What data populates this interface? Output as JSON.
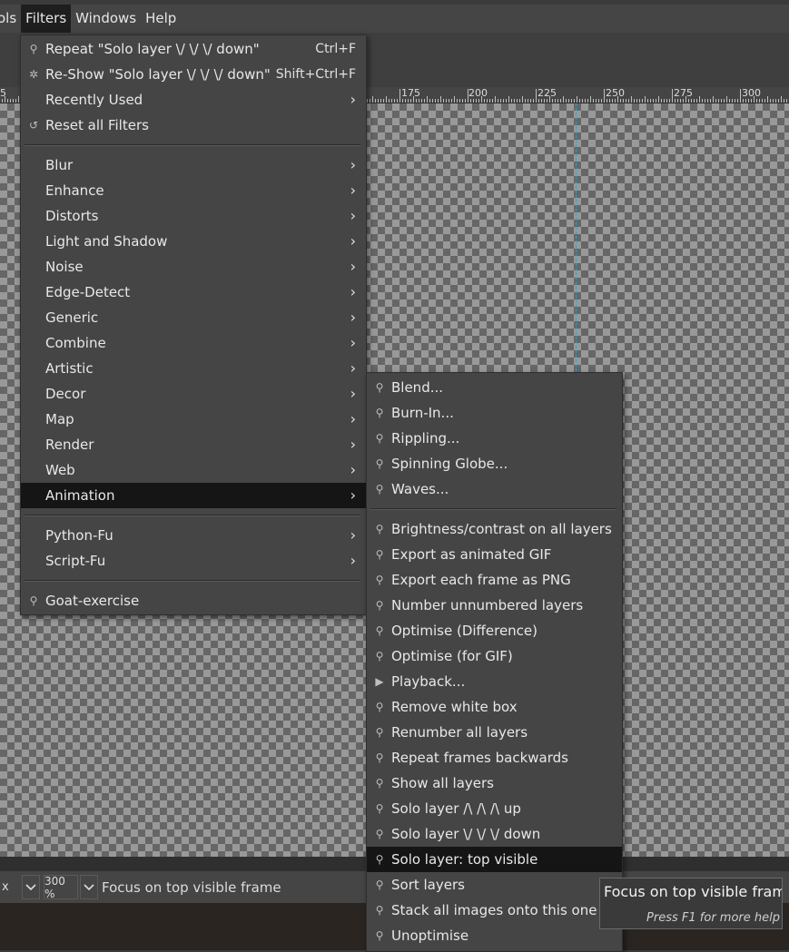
{
  "menubar": {
    "items": [
      {
        "label": "ols"
      },
      {
        "label": "Filters"
      },
      {
        "label": "Windows"
      },
      {
        "label": "Help"
      }
    ]
  },
  "ruler": {
    "labels": [
      "175",
      "200",
      "225",
      "250",
      "275",
      "300"
    ],
    "left_label": "5"
  },
  "statusbar": {
    "unit": "x",
    "zoom": "300 %",
    "message": "Focus on top visible frame"
  },
  "filters_menu": {
    "repeat_label": "Repeat \"Solo layer \\/ \\/ \\/ down\"",
    "repeat_shortcut": "Ctrl+F",
    "reshow_label": "Re-Show \"Solo layer \\/ \\/ \\/ down\"",
    "reshow_shortcut": "Shift+Ctrl+F",
    "recently_used": "Recently Used",
    "reset_all": "Reset all Filters",
    "categories": [
      "Blur",
      "Enhance",
      "Distorts",
      "Light and Shadow",
      "Noise",
      "Edge-Detect",
      "Generic",
      "Combine",
      "Artistic",
      "Decor",
      "Map",
      "Render",
      "Web",
      "Animation"
    ],
    "script_groups": [
      "Python-Fu",
      "Script-Fu"
    ],
    "goat": "Goat-exercise"
  },
  "animation_menu": {
    "group1": [
      "Blend...",
      "Burn-In...",
      "Rippling...",
      "Spinning Globe...",
      "Waves..."
    ],
    "group2": [
      "Brightness/contrast on all layers",
      "Export as animated GIF",
      "Export each frame as PNG",
      "Number unnumbered layers",
      "Optimise (Difference)",
      "Optimise (for GIF)",
      "Playback...",
      "Remove white box",
      "Renumber all layers",
      "Repeat frames backwards",
      "Show all layers",
      "Solo layer /\\ /\\ /\\ up",
      "Solo layer \\/ \\/ \\/ down",
      "Solo layer: top visible",
      "Sort layers",
      "Stack all images onto this one",
      "Unoptimise"
    ]
  },
  "tooltip": {
    "title": "Focus on top visible frame",
    "help": "Press F1 for more help"
  }
}
